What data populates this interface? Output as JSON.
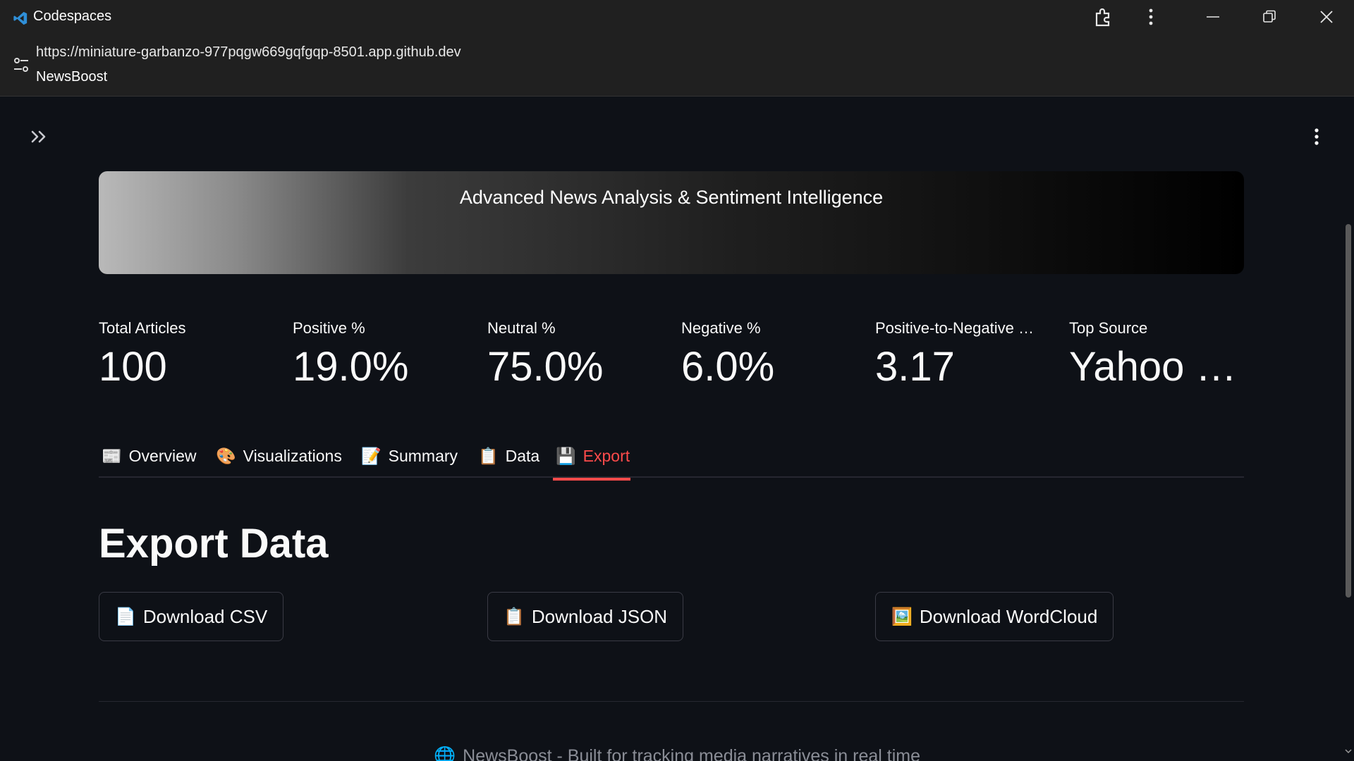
{
  "window": {
    "title": "Codespaces"
  },
  "address": {
    "url": "https://miniature-garbanzo-977pqgw669gqfgqp-8501.app.github.dev",
    "page_name": "NewsBoost"
  },
  "icons": {
    "app": "vscode-icon",
    "extension": "extension-icon",
    "kebab": "more-vertical-icon",
    "minimize": "minimize-icon",
    "restore": "restore-icon",
    "close": "close-icon",
    "site_settings": "sliders-icon",
    "sidebar": "double-chevron-right-icon"
  },
  "banner": {
    "tagline": "Advanced News Analysis & Sentiment Intelligence"
  },
  "metrics": [
    {
      "label": "Total Articles",
      "value": "100"
    },
    {
      "label": "Positive %",
      "value": "19.0%"
    },
    {
      "label": "Neutral %",
      "value": "75.0%"
    },
    {
      "label": "Negative %",
      "value": "6.0%"
    },
    {
      "label": "Positive-to-Negative …",
      "value": "3.17"
    },
    {
      "label": "Top Source",
      "value": "Yahoo …"
    }
  ],
  "tabs": [
    {
      "emoji": "📰",
      "label": "Overview"
    },
    {
      "emoji": "🎨",
      "label": "Visualizations"
    },
    {
      "emoji": "📝",
      "label": "Summary"
    },
    {
      "emoji": "📋",
      "label": "Data"
    },
    {
      "emoji": "💾",
      "label": "Export",
      "active": true
    }
  ],
  "export": {
    "title": "Export Data",
    "buttons": [
      {
        "emoji": "📄",
        "label": "Download CSV"
      },
      {
        "emoji": "📋",
        "label": "Download JSON"
      },
      {
        "emoji": "🖼️",
        "label": "Download WordCloud"
      }
    ]
  },
  "footer": {
    "emoji": "🌐",
    "text": "NewsBoost - Built for tracking media narratives in real time"
  },
  "colors": {
    "accent": "#ff4b4b",
    "background": "#0e1117",
    "chrome": "#202020"
  }
}
